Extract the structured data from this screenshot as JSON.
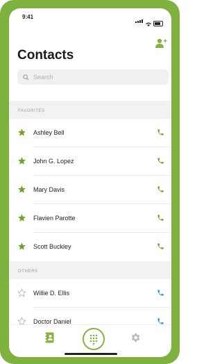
{
  "status_bar": {
    "time": "9:41"
  },
  "header": {
    "title": "Contacts",
    "add_icon": "add-contact-icon"
  },
  "search": {
    "placeholder": "Search"
  },
  "sections": {
    "favorites": "FAVORITES",
    "others": "OTHERS"
  },
  "favorites": [
    {
      "name": "Ashley Bell"
    },
    {
      "name": "John G. Lopez"
    },
    {
      "name": "Mary Davis"
    },
    {
      "name": "Flavien Parotte"
    },
    {
      "name": "Scott Buckley"
    }
  ],
  "others": [
    {
      "name": "Willie D. Ellis"
    },
    {
      "name": "Doctor Daniel"
    }
  ],
  "colors": {
    "frame": "#7fb13f",
    "favorite_star": "#6fa32e",
    "favorite_phone": "#6fa32e",
    "other_phone": "#1a9bd7"
  },
  "tabbar": {
    "items": [
      "contacts-tab-icon",
      "dialpad-tab-icon",
      "settings-tab-icon"
    ]
  }
}
